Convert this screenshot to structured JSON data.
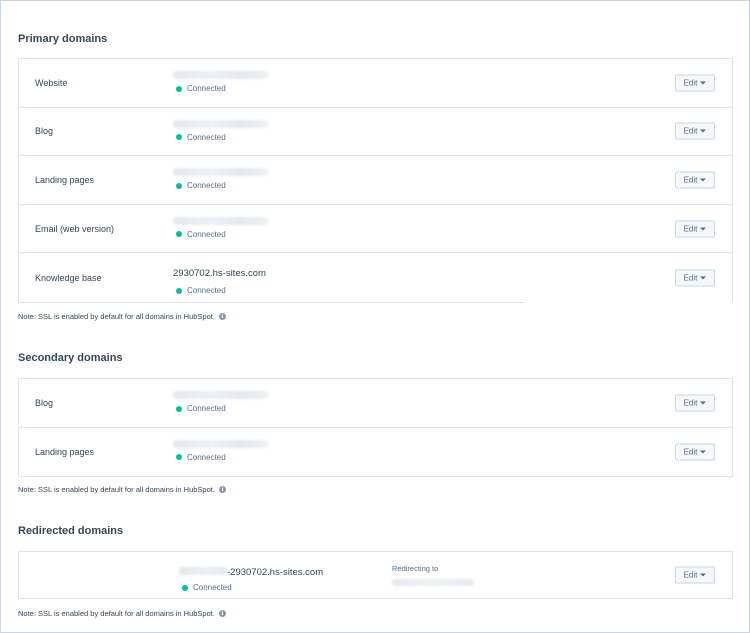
{
  "sections": {
    "primary": {
      "title": "Primary domains",
      "note": "Note: SSL is enabled by default for all domains in HubSpot.",
      "rows": [
        {
          "label": "Website",
          "status": "Connected",
          "edit": "Edit"
        },
        {
          "label": "Blog",
          "status": "Connected",
          "edit": "Edit"
        },
        {
          "label": "Landing pages",
          "status": "Connected",
          "edit": "Edit"
        },
        {
          "label": "Email (web version)",
          "status": "Connected",
          "edit": "Edit"
        },
        {
          "label": "Knowledge base",
          "domain": "2930702.hs-sites.com",
          "status": "Connected",
          "edit": "Edit"
        }
      ]
    },
    "secondary": {
      "title": "Secondary domains",
      "note": "Note: SSL is enabled by default for all domains in HubSpot.",
      "rows": [
        {
          "label": "Blog",
          "status": "Connected",
          "edit": "Edit"
        },
        {
          "label": "Landing pages",
          "status": "Connected",
          "edit": "Edit"
        }
      ]
    },
    "redirected": {
      "title": "Redirected domains",
      "note": "Note: SSL is enabled by default for all domains in HubSpot.",
      "rows": [
        {
          "domain_suffix": "-2930702.hs-sites.com",
          "status": "Connected",
          "redirect_label": "Redirecting to",
          "edit": "Edit"
        }
      ]
    }
  },
  "icons": {
    "info": "info-icon",
    "caret": "caret-down-icon",
    "status_dot": "status-dot-icon"
  },
  "colors": {
    "connected": "#00bda5",
    "text": "#33475b",
    "border": "#dfe3eb"
  }
}
